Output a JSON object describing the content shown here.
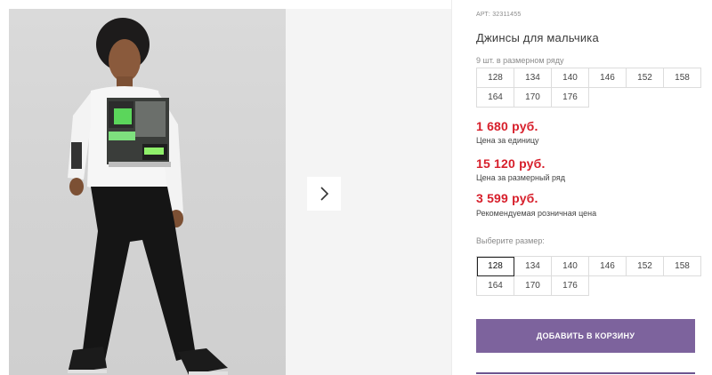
{
  "product": {
    "article": "АРТ: 32311455",
    "title": "Джинсы для мальчика",
    "range_note": "9 шт. в размерном ряду"
  },
  "size_range": [
    "128",
    "134",
    "140",
    "146",
    "152",
    "158",
    "164",
    "170",
    "176"
  ],
  "prices": [
    {
      "value": "1 680 руб.",
      "caption": "Цена за единицу"
    },
    {
      "value": "15 120 руб.",
      "caption": "Цена за размерный ряд"
    },
    {
      "value": "3 599 руб.",
      "caption": "Рекомендуемая розничная цена"
    }
  ],
  "size_select": {
    "label": "Выберите размер:",
    "options": [
      "128",
      "134",
      "140",
      "146",
      "152",
      "158",
      "164",
      "170",
      "176"
    ],
    "selected": "128"
  },
  "cart_button": {
    "label": "ДОБАВИТЬ В КОРЗИНУ"
  },
  "gallery": {
    "next_icon": "chevron-right-icon"
  },
  "colors": {
    "price": "#d71f2b",
    "accent": "#7d639d"
  }
}
